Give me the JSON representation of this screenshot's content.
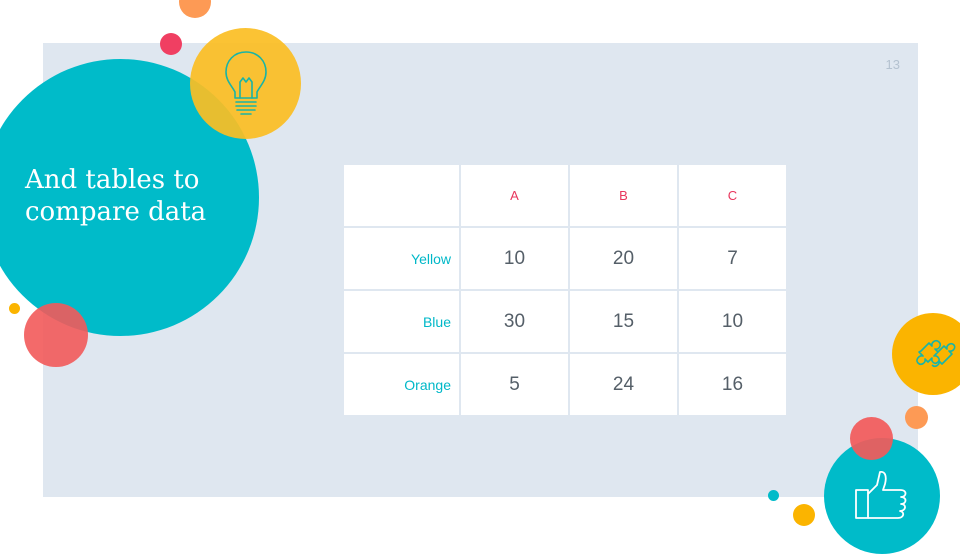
{
  "slide": {
    "title_line1": "And tables to",
    "title_line2": "compare data",
    "page_number": "13"
  },
  "table": {
    "columns": [
      "",
      "A",
      "B",
      "C"
    ],
    "rows": [
      {
        "label": "Yellow",
        "values": [
          "10",
          "20",
          "7"
        ]
      },
      {
        "label": "Blue",
        "values": [
          "30",
          "15",
          "10"
        ]
      },
      {
        "label": "Orange",
        "values": [
          "5",
          "24",
          "16"
        ]
      }
    ]
  },
  "colors": {
    "teal": "#00bbc9",
    "yellow": "#fbc02d",
    "red": "#f26464",
    "pink": "#f03f62",
    "orange": "#fd9a55",
    "amber": "#fbb400",
    "panel": "#dfe7f0",
    "header_text": "#e8365d",
    "row_label_text": "#00b8c8"
  },
  "icons": [
    "lightbulb-icon",
    "puzzle-icon",
    "thumbs-up-icon"
  ]
}
